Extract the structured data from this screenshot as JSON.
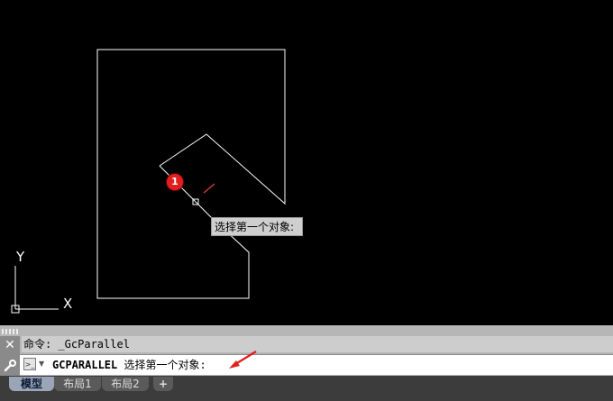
{
  "tooltip": {
    "text": "选择第一个对象:"
  },
  "step_badge": {
    "text": "1"
  },
  "ucs": {
    "x_label": "X",
    "y_label": "Y"
  },
  "command": {
    "history": "命令: _GcParallel",
    "current_command": "GCPARALLEL",
    "current_prompt": " 选择第一个对象:"
  },
  "tabs": [
    {
      "label": "模型",
      "active": true
    },
    {
      "label": "布局1",
      "active": false
    },
    {
      "label": "布局2",
      "active": false
    },
    {
      "label": "+",
      "active": false
    }
  ],
  "colors": {
    "canvas": "#000000",
    "lines": "#ffffff",
    "badge": "#e02020",
    "arrow": "#e02020"
  }
}
